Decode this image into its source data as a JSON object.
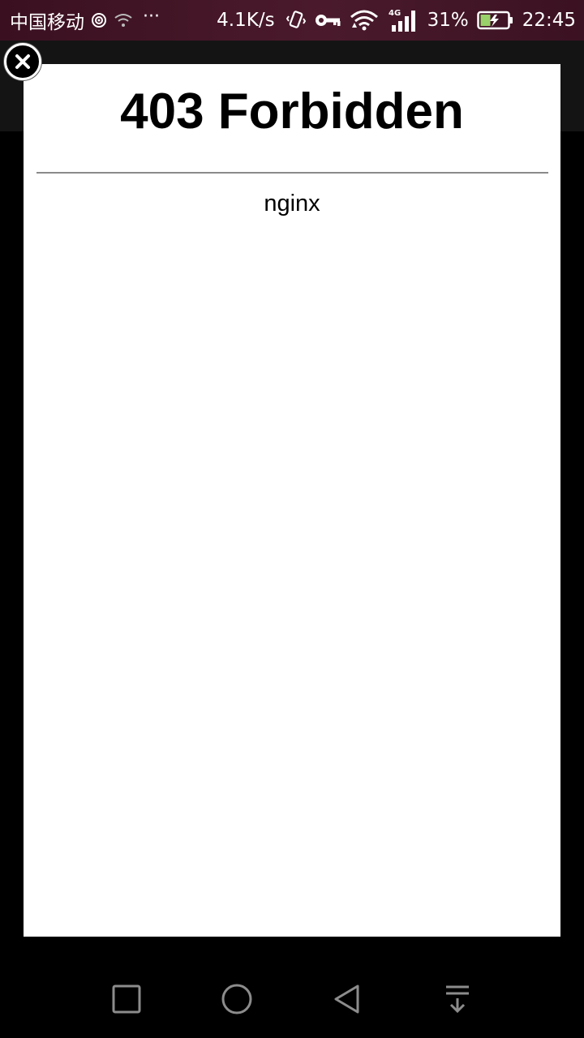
{
  "status_bar": {
    "carrier": "中国移动",
    "net_speed": "4.1K/s",
    "battery_percent": "31%",
    "time": "22:45",
    "network_type": "4G",
    "icons": [
      "hotspot-icon",
      "wifi-weak-icon",
      "vibrate-icon",
      "key-icon",
      "wifi-icon",
      "signal-icon",
      "battery-charging-icon"
    ]
  },
  "dialog": {
    "heading": "403 Forbidden",
    "server": "nginx",
    "close_icon": "close-icon"
  },
  "nav_bar": {
    "buttons": [
      "recent-apps-icon",
      "home-icon",
      "back-icon",
      "notification-pull-icon"
    ]
  },
  "colors": {
    "status_bar_bg": "#4a1a2c",
    "dialog_bg": "#ffffff",
    "backdrop": "#000000",
    "battery_accent": "#9ad26a"
  }
}
